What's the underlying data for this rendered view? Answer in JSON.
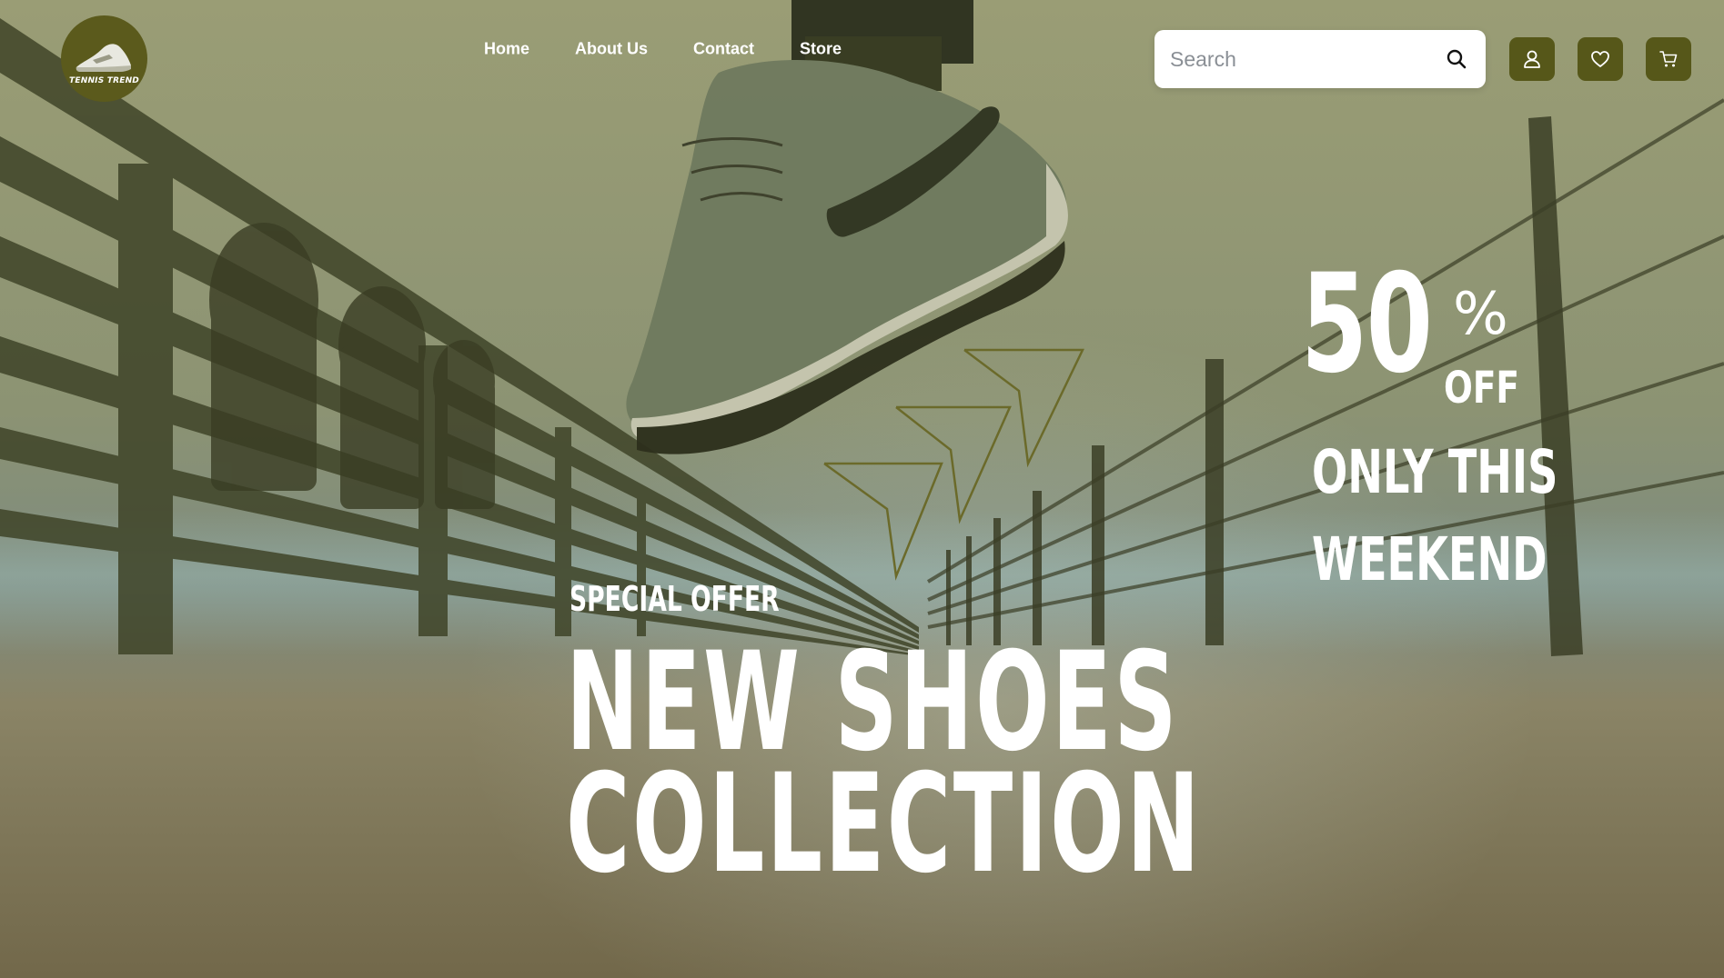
{
  "brand": {
    "logo_text": "TENNIS TREND"
  },
  "nav": {
    "items": [
      {
        "label": "Home"
      },
      {
        "label": "About Us"
      },
      {
        "label": "Contact"
      },
      {
        "label": "Store"
      }
    ]
  },
  "search": {
    "placeholder": "Search",
    "icon": "search-icon"
  },
  "actions": {
    "icons": [
      "user-icon",
      "heart-icon",
      "cart-icon"
    ],
    "button_color": "#565719"
  },
  "promo": {
    "discount_number": "50",
    "percent_sign": "%",
    "off_label": "OFF",
    "line1": "ONLY THIS",
    "line2": "WEEKEND"
  },
  "hero": {
    "eyebrow": "SPECIAL OFFER",
    "title_line1": "NEW SHOES",
    "title_line2": "COLLECTION"
  },
  "colors": {
    "accent": "#565719",
    "text": "#ffffff",
    "chevron_stroke": "#6b6a2a"
  }
}
